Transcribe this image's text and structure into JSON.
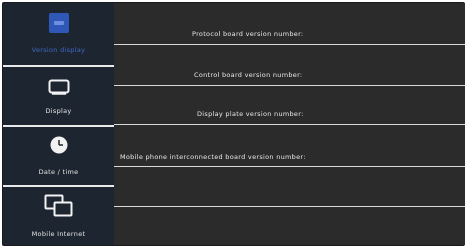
{
  "sidebar": {
    "items": [
      {
        "label": "Version display",
        "icon": "version-info-icon",
        "active": true
      },
      {
        "label": "Display",
        "icon": "display-icon",
        "active": false
      },
      {
        "label": "Date / time",
        "icon": "clock-icon",
        "active": false
      },
      {
        "label": "Mobile Internet",
        "icon": "mobile-internet-icon",
        "active": false
      }
    ]
  },
  "main": {
    "rows": [
      {
        "label": "Protocol board version number:"
      },
      {
        "label": "Control board version number:"
      },
      {
        "label": "Display plate version number:"
      },
      {
        "label": "Mobile phone interconnected board version number:"
      }
    ]
  },
  "colors": {
    "sidebar_bg": "#1d2630",
    "main_bg": "#2b2b2b",
    "accent": "#3f67c7",
    "text": "#e6e6e6"
  }
}
